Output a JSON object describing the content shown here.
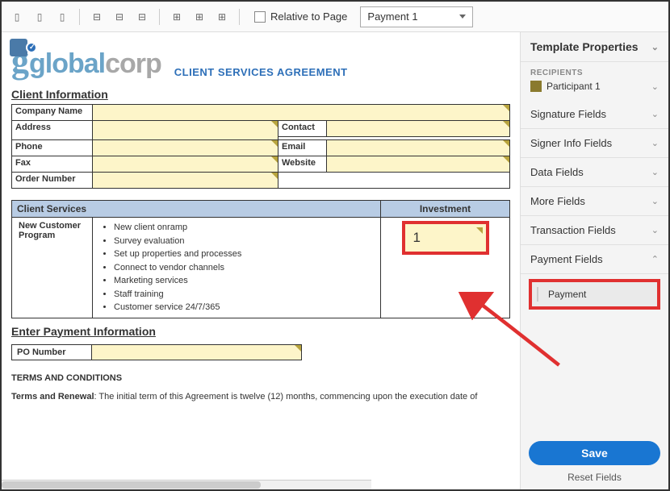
{
  "toolbar": {
    "relative_label": "Relative to Page",
    "dropdown_value": "Payment 1"
  },
  "doc": {
    "logo_main": "global",
    "logo_suffix": "corp",
    "title": "CLIENT SERVICES AGREEMENT",
    "section_client_info": "Client Information",
    "labels": {
      "company": "Company Name",
      "address": "Address",
      "contact": "Contact",
      "phone": "Phone",
      "email": "Email",
      "fax": "Fax",
      "website": "Website",
      "order_number": "Order Number"
    },
    "services_header": "Client Services",
    "investment_header": "Investment",
    "program_name": "New Customer Program",
    "services_list": [
      "New client onramp",
      "Survey evaluation",
      "Set up properties and processes",
      "Connect to vendor channels",
      "Marketing services",
      "Staff training",
      "Customer service 24/7/365"
    ],
    "investment_value": "1",
    "section_payment": "Enter Payment Information",
    "po_label": "PO Number",
    "terms_head": "TERMS AND CONDITIONS",
    "terms_body": "Terms and Renewal: The initial term of this Agreement is twelve (12) months, commencing upon the execution date of"
  },
  "sidebar": {
    "template_props": "Template Properties",
    "recipients_label": "RECIPIENTS",
    "participant": "Participant 1",
    "groups": {
      "signature": "Signature Fields",
      "signer_info": "Signer Info Fields",
      "data": "Data Fields",
      "more": "More Fields",
      "transaction": "Transaction Fields",
      "payment": "Payment Fields"
    },
    "payment_item": "Payment",
    "save": "Save",
    "reset": "Reset Fields"
  }
}
